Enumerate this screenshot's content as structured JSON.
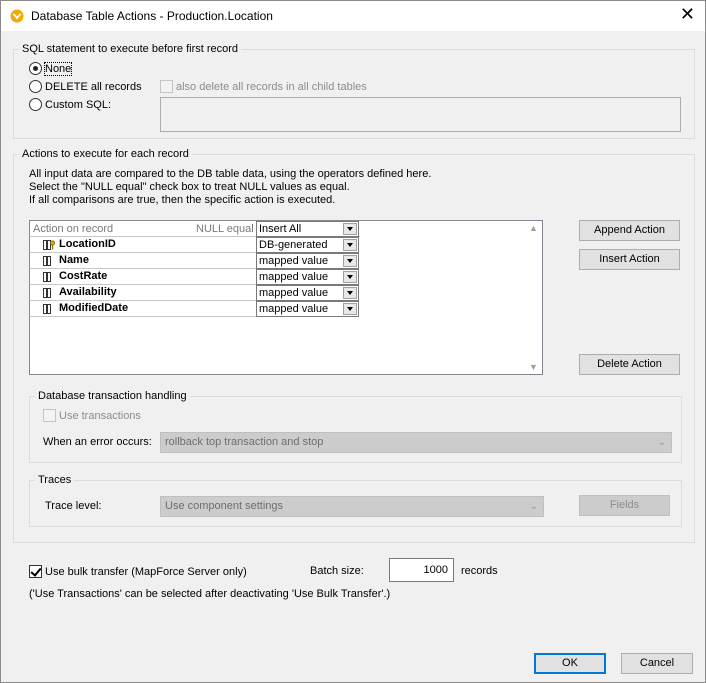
{
  "window": {
    "title": "Database Table Actions - Production.Location",
    "close_glyph": "✕"
  },
  "sql_before": {
    "legend": "SQL statement to execute before first record",
    "options": {
      "none": "None",
      "delete_all": "DELETE all records",
      "custom": "Custom SQL:"
    },
    "selected": "none",
    "child_tables_label": "also delete all records in all child tables"
  },
  "actions": {
    "legend": "Actions to execute for each record",
    "description": [
      "All input data are compared to the DB table data, using the operators defined here.",
      "Select the \"NULL equal\" check box to treat NULL values as equal.",
      "If all comparisons are true, then the specific action is executed."
    ],
    "grid": {
      "col_action": "Action on record",
      "col_null_equal": "NULL equal",
      "action_value": "Insert All",
      "rows": [
        {
          "name": "LocationID",
          "value": "DB-generated",
          "key": true
        },
        {
          "name": "Name",
          "value": "mapped value",
          "key": false
        },
        {
          "name": "CostRate",
          "value": "mapped value",
          "key": false
        },
        {
          "name": "Availability",
          "value": "mapped value",
          "key": false
        },
        {
          "name": "ModifiedDate",
          "value": "mapped value",
          "key": false
        }
      ]
    },
    "buttons": {
      "append": "Append Action",
      "insert": "Insert Action",
      "delete": "Delete Action"
    }
  },
  "transaction": {
    "legend": "Database transaction handling",
    "use_transactions_label": "Use transactions",
    "error_label": "When an error occurs:",
    "error_value": "rollback top transaction and stop"
  },
  "traces": {
    "legend": "Traces",
    "trace_level_label": "Trace level:",
    "trace_level_value": "Use component settings",
    "fields_button": "Fields"
  },
  "bulk": {
    "label": "Use bulk transfer (MapForce Server only)",
    "checked": true,
    "batch_size_label": "Batch size:",
    "batch_size_value": "1000",
    "records_label": "records",
    "note": "('Use Transactions' can be selected after deactivating 'Use Bulk Transfer'.)"
  },
  "footer": {
    "ok": "OK",
    "cancel": "Cancel"
  },
  "colors": {
    "accent": "#0078d7",
    "app_icon": "#f5a800"
  }
}
